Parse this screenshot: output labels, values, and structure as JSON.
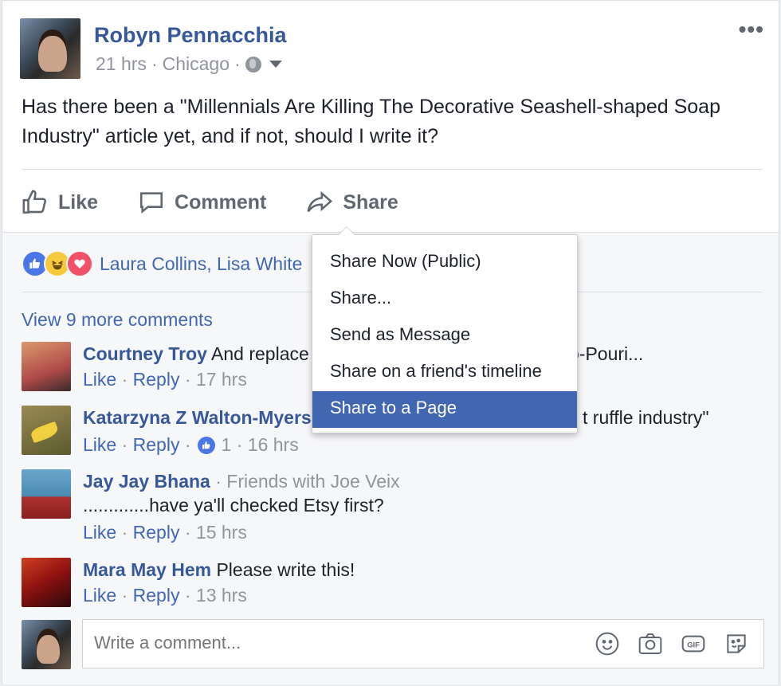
{
  "post": {
    "author": "Robyn Pennacchia",
    "time": "21 hrs",
    "location": "Chicago",
    "separator": "·",
    "text": "Has there been a \"Millennials Are Killing The Decorative Seashell-shaped Soap Industry\" article yet, and if not, should I write it?",
    "more_icon": "more-horizontal-icon",
    "privacy_icon": "globe-icon"
  },
  "actions": {
    "like": "Like",
    "comment": "Comment",
    "share": "Share"
  },
  "reactions": {
    "icons": [
      "like-reaction-icon",
      "haha-reaction-icon",
      "love-reaction-icon"
    ],
    "names": "Laura Collins, Lisa White"
  },
  "view_more": "View 9 more comments",
  "comments": [
    {
      "author": "Courtney Troy",
      "text": "And replace",
      "text_tail": "o-Pouri...",
      "like": "Like",
      "reply": "Reply",
      "time": "17 hrs"
    },
    {
      "author": "Katarzyna Z Walton-Myers",
      "text": "",
      "text_tail": "t ruffle industry\"",
      "like": "Like",
      "reply": "Reply",
      "likes": "1",
      "time": "16 hrs"
    },
    {
      "author": "Jay Jay Bhana",
      "friends": "Friends with Joe Veix",
      "text": ".............have ya'll checked Etsy first?",
      "like": "Like",
      "reply": "Reply",
      "time": "15 hrs"
    },
    {
      "author": "Mara May Hem",
      "text": "Please write this!",
      "like": "Like",
      "reply": "Reply",
      "time": "13 hrs"
    }
  ],
  "composer": {
    "placeholder": "Write a comment...",
    "icons": [
      "emoji-icon",
      "camera-icon",
      "gif-icon",
      "sticker-icon"
    ]
  },
  "share_menu": {
    "items": [
      "Share Now (Public)",
      "Share...",
      "Send as Message",
      "Share on a friend's timeline",
      "Share to a Page"
    ],
    "selected": "Share to a Page"
  },
  "colors": {
    "link": "#365899",
    "accent": "#4267b2",
    "muted": "#90949c",
    "like_blue": "#4a76e8",
    "love_red": "#f25268",
    "haha_yellow": "#f7c93d"
  }
}
